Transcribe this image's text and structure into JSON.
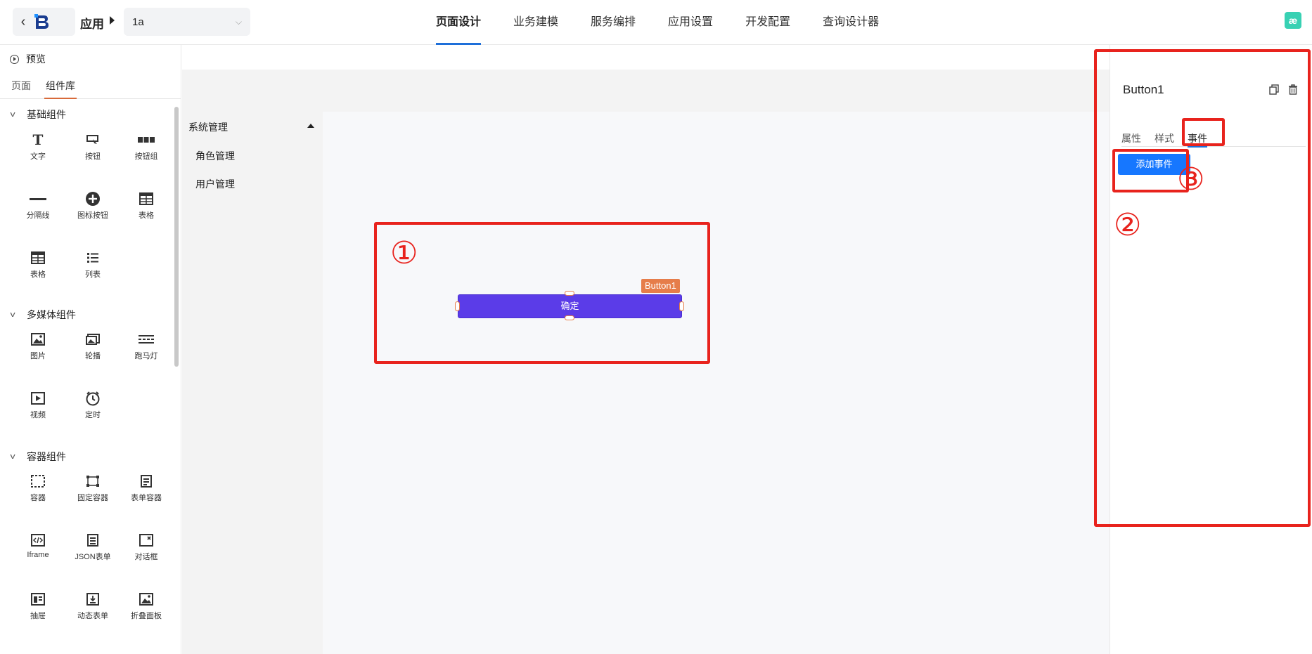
{
  "topbar": {
    "back_icon": "chevron-left-icon",
    "app_label": "应用",
    "app_select_value": "1a",
    "nav": [
      {
        "label": "页面设计",
        "active": true
      },
      {
        "label": "业务建模",
        "active": false
      },
      {
        "label": "服务编排",
        "active": false
      },
      {
        "label": "应用设置",
        "active": false
      },
      {
        "label": "开发配置",
        "active": false
      },
      {
        "label": "查询设计器",
        "active": false
      }
    ],
    "user_logo_text": "æ"
  },
  "left_panel": {
    "preview_label": "预览",
    "tabs": [
      {
        "label": "页面",
        "active": false
      },
      {
        "label": "组件库",
        "active": true
      }
    ],
    "groups": [
      {
        "title": "基础组件",
        "items": [
          {
            "label": "文字",
            "icon": "text-icon"
          },
          {
            "label": "按钮",
            "icon": "button-cursor-icon"
          },
          {
            "label": "按钮组",
            "icon": "button-group-icon"
          },
          {
            "label": "分隔线",
            "icon": "divider-icon"
          },
          {
            "label": "图标按钮",
            "icon": "plus-circle-icon"
          },
          {
            "label": "表格",
            "icon": "table-icon"
          },
          {
            "label": "表格",
            "icon": "table-icon"
          },
          {
            "label": "列表",
            "icon": "list-icon"
          }
        ]
      },
      {
        "title": "多媒体组件",
        "items": [
          {
            "label": "图片",
            "icon": "image-icon"
          },
          {
            "label": "轮播",
            "icon": "carousel-icon"
          },
          {
            "label": "跑马灯",
            "icon": "marquee-icon"
          },
          {
            "label": "视频",
            "icon": "video-icon"
          },
          {
            "label": "定时",
            "icon": "clock-icon"
          }
        ]
      },
      {
        "title": "容器组件",
        "items": [
          {
            "label": "容器",
            "icon": "container-icon"
          },
          {
            "label": "固定容器",
            "icon": "fixed-container-icon"
          },
          {
            "label": "表单容器",
            "icon": "form-container-icon"
          },
          {
            "label": "Iframe",
            "icon": "iframe-icon"
          },
          {
            "label": "JSON表单",
            "icon": "json-form-icon"
          },
          {
            "label": "对话框",
            "icon": "dialog-icon"
          },
          {
            "label": "抽屉",
            "icon": "drawer-icon"
          },
          {
            "label": "动态表单",
            "icon": "dynamic-form-icon"
          },
          {
            "label": "折叠面板",
            "icon": "collapse-panel-icon"
          }
        ]
      }
    ]
  },
  "canvas": {
    "menu": {
      "head": "系统管理",
      "items": [
        "角色管理",
        "用户管理"
      ]
    },
    "selected_button": {
      "text": "确定",
      "tag": "Button1"
    }
  },
  "right_panel": {
    "title": "Button1",
    "tabs": [
      {
        "label": "属性",
        "active": false
      },
      {
        "label": "样式",
        "active": false
      },
      {
        "label": "事件",
        "active": true
      }
    ],
    "add_event_label": "添加事件"
  },
  "annotations": {
    "mark1": "①",
    "mark2": "②",
    "mark3": "③"
  },
  "colors": {
    "accent": "#1e6fd9",
    "button": "#5b3ce8",
    "selection": "#e67d4a",
    "annotation": "#e8231d"
  }
}
